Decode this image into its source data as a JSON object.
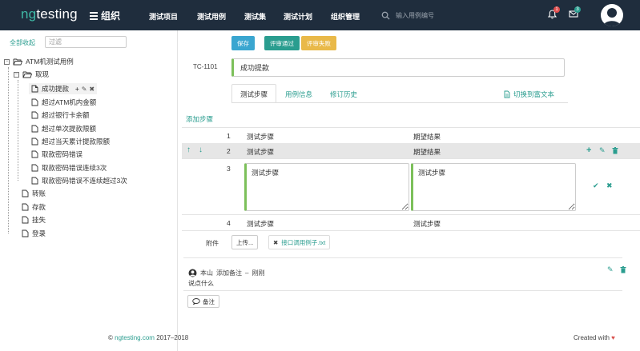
{
  "header": {
    "logo_ng": "ng",
    "logo_rest": "testing",
    "org_label": "组织",
    "nav": [
      "测试项目",
      "测试用例",
      "测试集",
      "测试计划",
      "组织管理"
    ],
    "search_placeholder": "输入用例编号",
    "bell_badge": "1",
    "mail_badge": "3",
    "bell_badge_color": "#e04e4e",
    "mail_badge_color": "#2a9d8f"
  },
  "sidebar": {
    "collapse_all": "全部收起",
    "filter_placeholder": "过滤",
    "tree": {
      "root": "ATM机测试用例",
      "folder": "取现",
      "cases": [
        "成功提款",
        "超过ATM机内金额",
        "超过银行卡余额",
        "超过单次提款限额",
        "超过当天累计提款限额",
        "取款密码错误",
        "取款密码错误连续3次",
        "取款密码错误不连续超过3次"
      ],
      "others": [
        "转账",
        "存款",
        "挂失",
        "登录"
      ]
    }
  },
  "toolbar": {
    "save": "保存",
    "pass": "评审通过",
    "fail": "评审失败"
  },
  "case": {
    "id": "TC-1101",
    "title": "成功提款"
  },
  "tabs": [
    "测试步骤",
    "用例信息",
    "修订历史"
  ],
  "rich_text_switch": "切换到富文本",
  "add_step": "添加步骤",
  "steps": [
    {
      "num": "1",
      "step": "测试步骤",
      "expect": "期望结果"
    },
    {
      "num": "2",
      "step": "测试步骤",
      "expect": "期望结果"
    },
    {
      "num": "3",
      "step": "测试步骤",
      "expect": "测试步骤"
    },
    {
      "num": "4",
      "step": "测试步骤",
      "expect": "测试步骤"
    }
  ],
  "attachments": {
    "label": "附件",
    "upload": "上传...",
    "file": "接口调用例子.txt"
  },
  "comment": {
    "author": "本山",
    "action": "添加备注",
    "dash": "–",
    "time": "刚刚",
    "body": "说点什么",
    "note_button": "备注"
  },
  "footer": {
    "copyright_symbol": "©",
    "site": "ngtesting.com",
    "years": "2017–2018",
    "created_with": "Created with",
    "heart": "♥"
  },
  "colors": {
    "nav_bg": "#1f2d3d",
    "accent": "#2a9d8f",
    "save_button": "#3aa6d0",
    "fail_button": "#e9b949",
    "focus_border": "#7cc05a"
  }
}
